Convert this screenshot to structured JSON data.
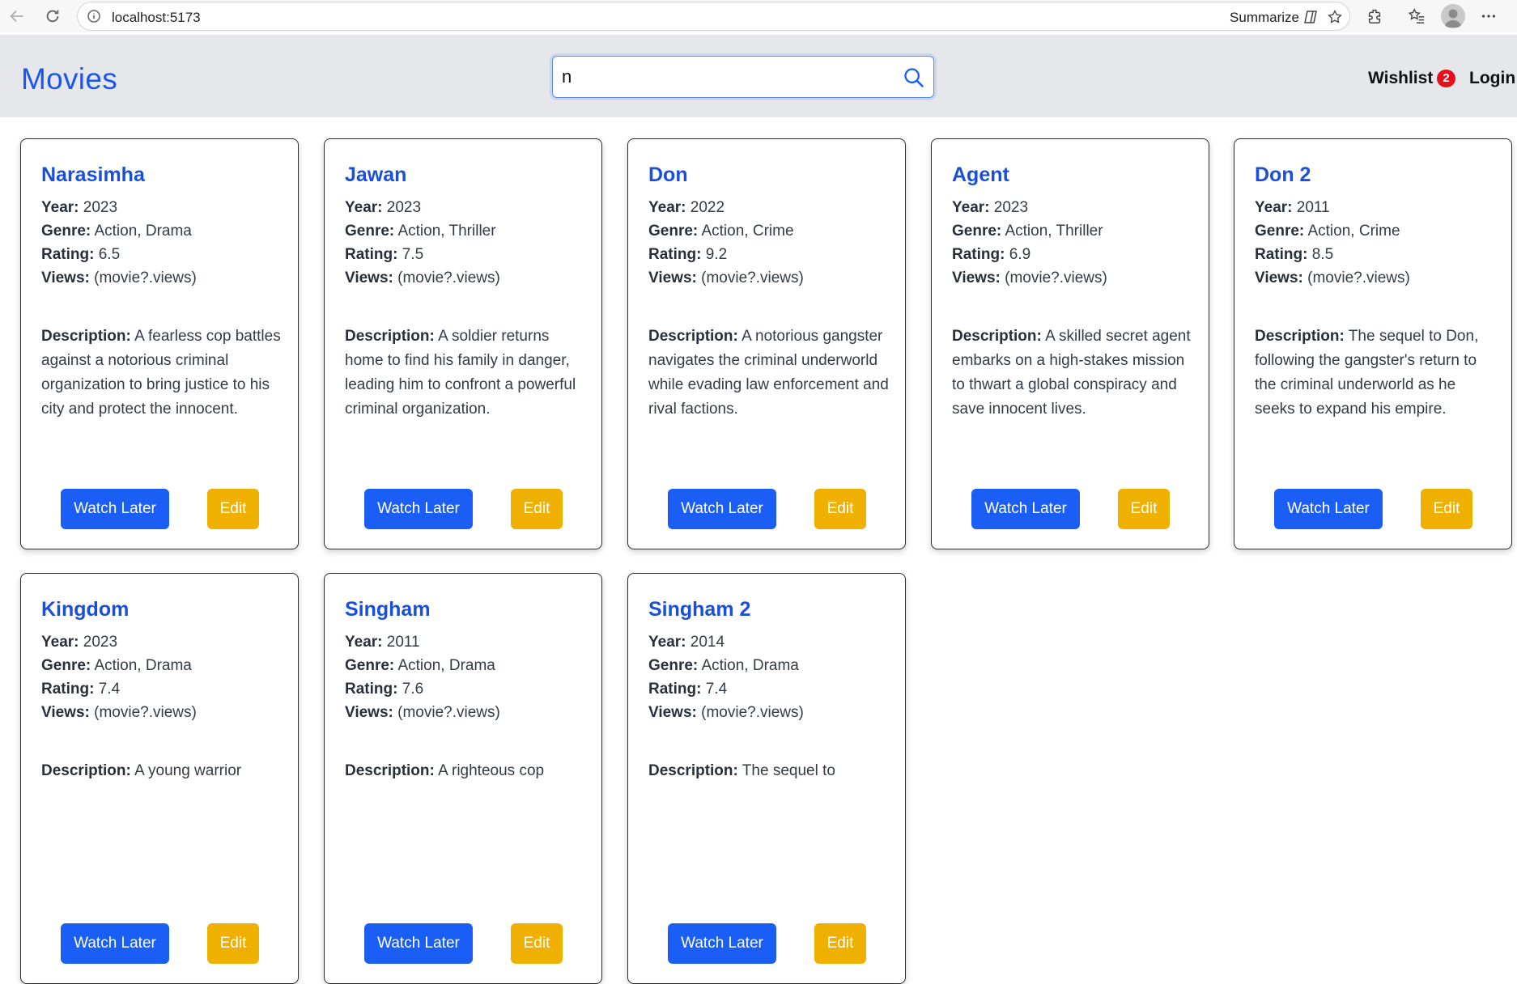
{
  "browser": {
    "url": "localhost:5173",
    "summarize_label": "Summarize",
    "icons": [
      "back-icon",
      "reload-icon",
      "info-icon",
      "copilot-icon",
      "star-icon",
      "extensions-icon",
      "favorites-icon",
      "profile-icon",
      "more-icon"
    ]
  },
  "header": {
    "brand": "Movies",
    "search_value": "n",
    "wishlist_label": "Wishlist",
    "wishlist_count": "2",
    "login_label": "Login"
  },
  "labels": {
    "year": "Year:",
    "genre": "Genre:",
    "rating": "Rating:",
    "views": "Views:",
    "description": "Description:",
    "watch_later": "Watch Later",
    "edit": "Edit"
  },
  "movies": [
    {
      "title": "Narasimha",
      "year": "2023",
      "genre": "Action, Drama",
      "rating": "6.5",
      "views": "(movie?.views)",
      "description": "A fearless cop battles against a notorious criminal organization to bring justice to his city and protect the innocent."
    },
    {
      "title": "Jawan",
      "year": "2023",
      "genre": "Action, Thriller",
      "rating": "7.5",
      "views": "(movie?.views)",
      "description": "A soldier returns home to find his family in danger, leading him to confront a powerful criminal organization."
    },
    {
      "title": "Don",
      "year": "2022",
      "genre": "Action, Crime",
      "rating": "9.2",
      "views": "(movie?.views)",
      "description": "A notorious gangster navigates the criminal underworld while evading law enforcement and rival factions."
    },
    {
      "title": "Agent",
      "year": "2023",
      "genre": "Action, Thriller",
      "rating": "6.9",
      "views": "(movie?.views)",
      "description": "A skilled secret agent embarks on a high-stakes mission to thwart a global conspiracy and save innocent lives."
    },
    {
      "title": "Don 2",
      "year": "2011",
      "genre": "Action, Crime",
      "rating": "8.5",
      "views": "(movie?.views)",
      "description": "The sequel to Don, following the gangster's return to the criminal underworld as he seeks to expand his empire."
    },
    {
      "title": "Kingdom",
      "year": "2023",
      "genre": "Action, Drama",
      "rating": "7.4",
      "views": "(movie?.views)",
      "description": "A young warrior"
    },
    {
      "title": "Singham",
      "year": "2011",
      "genre": "Action, Drama",
      "rating": "7.6",
      "views": "(movie?.views)",
      "description": "A righteous cop"
    },
    {
      "title": "Singham 2",
      "year": "2014",
      "genre": "Action, Drama",
      "rating": "7.4",
      "views": "(movie?.views)",
      "description": "The sequel to"
    }
  ],
  "colors": {
    "brand_blue": "#1a56f0",
    "watch_later_bg": "#1a5ef5",
    "edit_bg": "#efb000",
    "badge_bg": "#e5101c",
    "header_bg": "#e5e7eb"
  }
}
